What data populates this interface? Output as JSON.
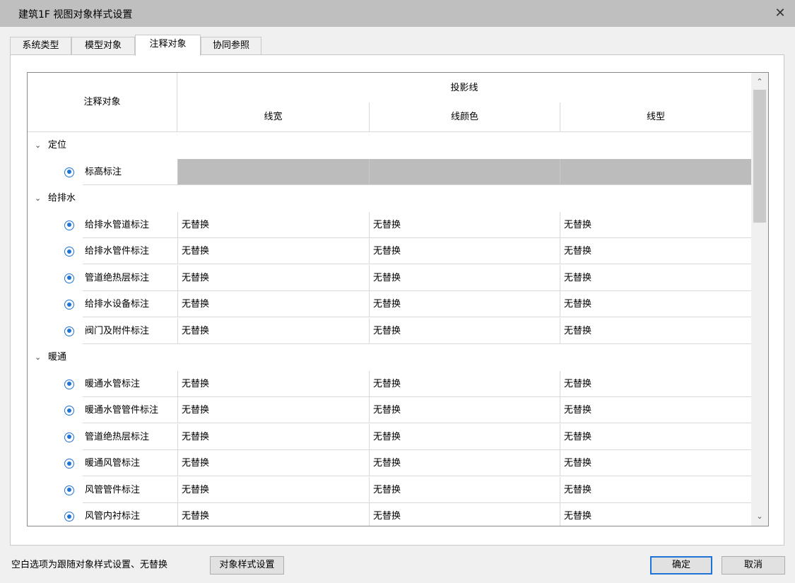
{
  "window": {
    "title": "建筑1F 视图对象样式设置",
    "close_glyph": "✕"
  },
  "tabs": [
    {
      "label": "系统类型",
      "active": false
    },
    {
      "label": "模型对象",
      "active": false
    },
    {
      "label": "注释对象",
      "active": true
    },
    {
      "label": "协同参照",
      "active": false
    }
  ],
  "table": {
    "header": {
      "object_col": "注释对象",
      "group": "投影线",
      "columns": [
        "线宽",
        "线颜色",
        "线型"
      ]
    },
    "groups": [
      {
        "label": "定位",
        "expanded": true,
        "items": [
          {
            "label": "标高标注",
            "visible": true,
            "disabled": true,
            "values": [
              "",
              "",
              ""
            ]
          }
        ]
      },
      {
        "label": "给排水",
        "expanded": true,
        "items": [
          {
            "label": "给排水管道标注",
            "visible": true,
            "values": [
              "无替换",
              "无替换",
              "无替换"
            ]
          },
          {
            "label": "给排水管件标注",
            "visible": true,
            "values": [
              "无替换",
              "无替换",
              "无替换"
            ]
          },
          {
            "label": "管道绝热层标注",
            "visible": true,
            "values": [
              "无替换",
              "无替换",
              "无替换"
            ]
          },
          {
            "label": "给排水设备标注",
            "visible": true,
            "values": [
              "无替换",
              "无替换",
              "无替换"
            ]
          },
          {
            "label": "阀门及附件标注",
            "visible": true,
            "values": [
              "无替换",
              "无替换",
              "无替换"
            ]
          }
        ]
      },
      {
        "label": "暖通",
        "expanded": true,
        "items": [
          {
            "label": "暖通水管标注",
            "visible": true,
            "values": [
              "无替换",
              "无替换",
              "无替换"
            ]
          },
          {
            "label": "暖通水管管件标注",
            "visible": true,
            "values": [
              "无替换",
              "无替换",
              "无替换"
            ]
          },
          {
            "label": "管道绝热层标注",
            "visible": true,
            "values": [
              "无替换",
              "无替换",
              "无替换"
            ]
          },
          {
            "label": "暖通风管标注",
            "visible": true,
            "values": [
              "无替换",
              "无替换",
              "无替换"
            ]
          },
          {
            "label": "风管管件标注",
            "visible": true,
            "values": [
              "无替换",
              "无替换",
              "无替换"
            ]
          },
          {
            "label": "风管内衬标注",
            "visible": true,
            "values": [
              "无替换",
              "无替换",
              "无替换"
            ]
          }
        ]
      }
    ]
  },
  "scrollbar": {
    "up_glyph": "⌃",
    "down_glyph": "⌄"
  },
  "footer": {
    "note": "空白选项为跟随对象样式设置、无替换",
    "style_button": "对象样式设置",
    "ok_button": "确定",
    "cancel_button": "取消"
  },
  "icons": {
    "group_toggle": "chevron-down-icon",
    "visibility": "eye-icon"
  },
  "colors": {
    "accent": "#1e73d6",
    "titlebar": "#bfbfbf",
    "disabled_cell": "#bcbcbc"
  }
}
